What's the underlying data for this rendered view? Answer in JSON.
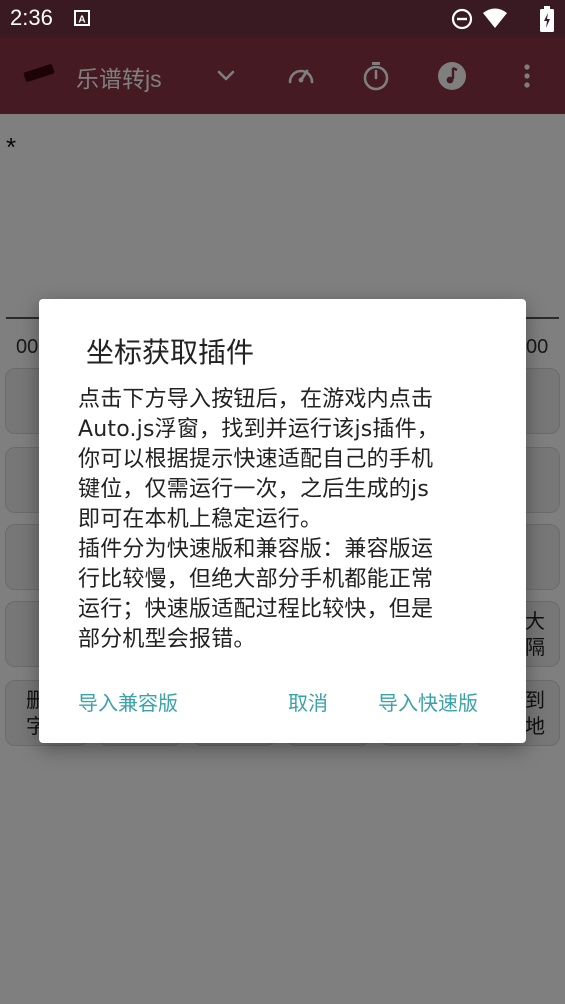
{
  "status_bar": {
    "time": "2:36",
    "icons": [
      "notification-a-icon",
      "do-not-disturb-icon",
      "wifi-icon",
      "battery-icon"
    ]
  },
  "toolbar": {
    "title": "乐谱转js",
    "icons": [
      "chevron-down-icon",
      "speed-icon",
      "timer-icon",
      "music-icon",
      "more-vert-icon"
    ],
    "background": "#8a3444"
  },
  "content": {
    "marker": "*",
    "left_value": "00",
    "right_value": "00",
    "visible_key_fragments": {
      "row4_right": [
        "大",
        "隔"
      ],
      "row5_left": [
        "删",
        "字"
      ],
      "row5_right": [
        "到",
        "地"
      ]
    }
  },
  "dialog": {
    "title": "坐标获取插件",
    "message": "点击下方导入按钮后，在游戏内点击\nAuto.js浮窗，找到并运行该js插件，\n你可以根据提示快速适配自己的手机\n键位，仅需运行一次，之后生成的js\n即可在本机上稳定运行。\n插件分为快速版和兼容版：兼容版运\n行比较慢，但绝大部分手机都能正常\n运行；快速版适配过程比较快，但是\n部分机型会报错。",
    "buttons": {
      "import_compatible": "导入兼容版",
      "cancel": "取消",
      "import_fast": "导入快速版"
    },
    "accent": "#3aa3a7"
  }
}
